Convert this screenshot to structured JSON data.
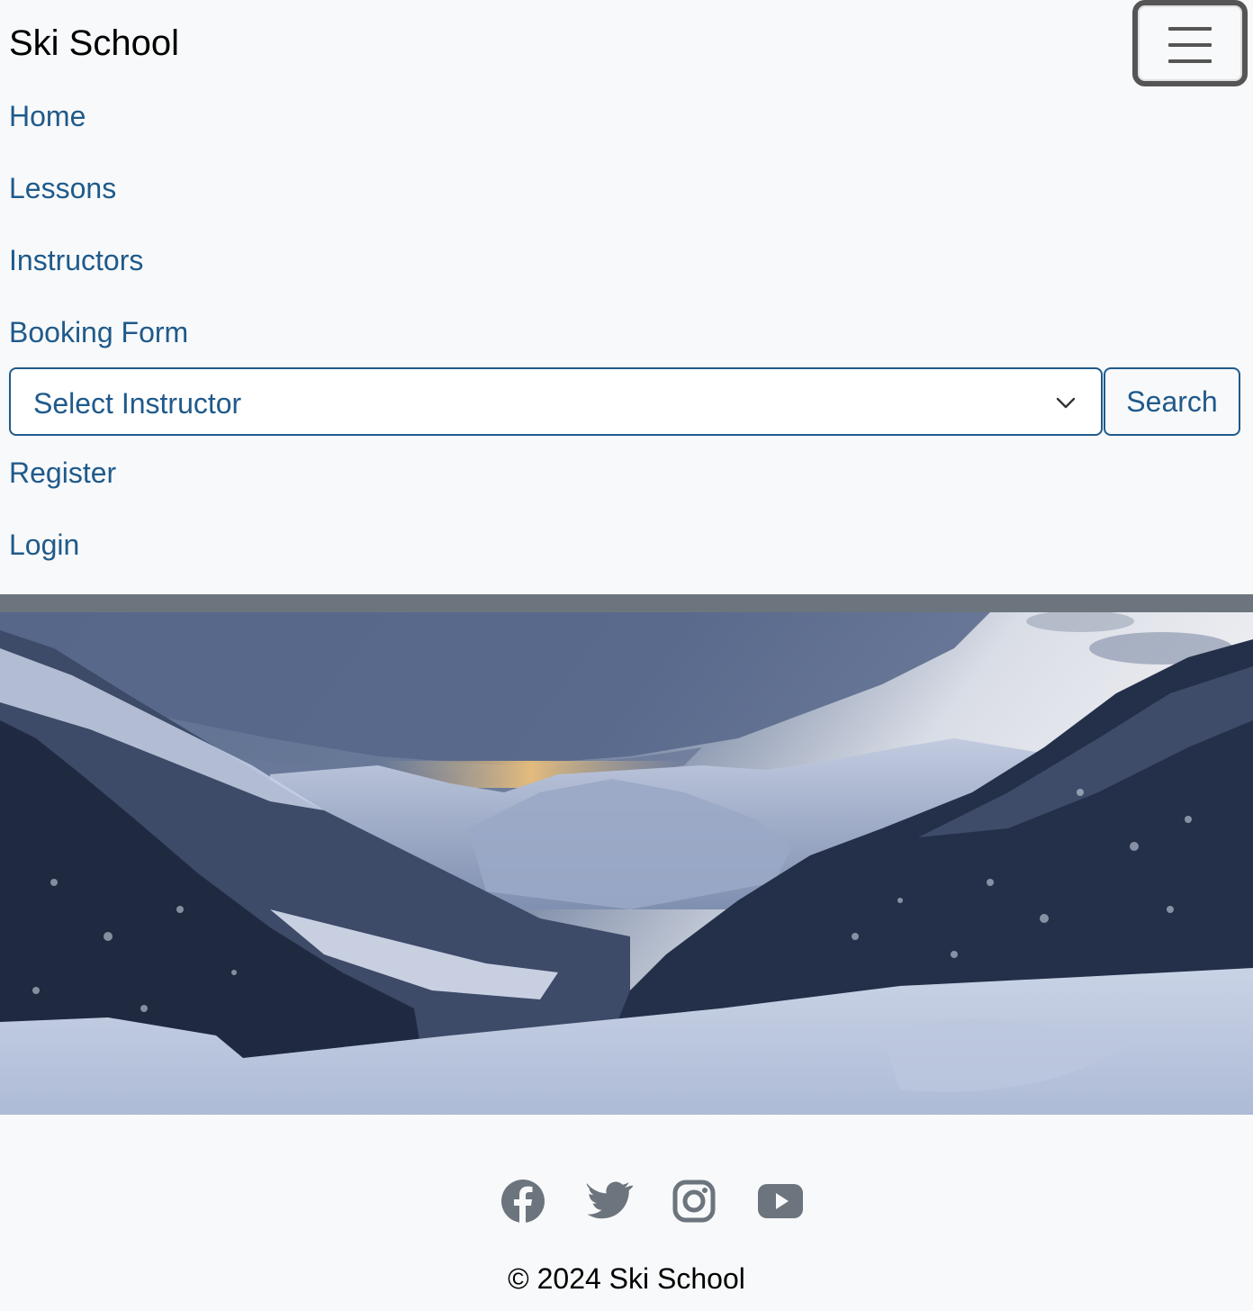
{
  "brand": "Ski School",
  "nav": {
    "toggler_icon": "hamburger-menu-icon",
    "items": [
      {
        "label": "Home"
      },
      {
        "label": "Lessons"
      },
      {
        "label": "Instructors"
      },
      {
        "label": "Booking Form"
      },
      {
        "label": "Register"
      },
      {
        "label": "Login"
      }
    ]
  },
  "search": {
    "select_value": "Select Instructor",
    "button_label": "Search"
  },
  "hero": {
    "image": "snowy mountain valley with pine forest at dusk"
  },
  "footer": {
    "social_icons": [
      "facebook-icon",
      "twitter-icon",
      "instagram-icon",
      "youtube-icon"
    ],
    "copyright": "© 2024 Ski School"
  },
  "colors": {
    "link": "#1f5a8b",
    "background": "#f8f9fa",
    "divider": "#6c757d",
    "icon": "#6c757d"
  }
}
